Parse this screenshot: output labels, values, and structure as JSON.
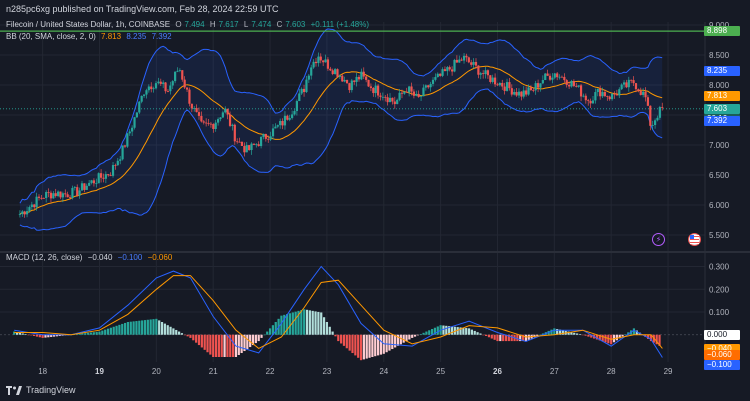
{
  "header": {
    "published": "n285pc6xg published on TradingView.com, Feb 28, 2024 22:59 UTC"
  },
  "symbol_legend": {
    "name": "Filecoin / United States Dollar, 1h, COINBASE",
    "o_label": "O",
    "o_value": "7.494",
    "h_label": "H",
    "h_value": "7.617",
    "l_label": "L",
    "l_value": "7.474",
    "c_label": "C",
    "c_value": "7.603",
    "change": "+0.111 (+1.48%)"
  },
  "bb_legend": {
    "label": "BB (20, SMA, close, 2, 0)",
    "basis": "7.813",
    "upper": "8.235",
    "lower": "7.392"
  },
  "macd_legend": {
    "label": "MACD (12, 26, close)",
    "hist": "−0.040",
    "macd": "−0.100",
    "signal": "−0.060"
  },
  "price_axis": {
    "ticks": [
      "9.000",
      "8.500",
      "8.000",
      "7.500",
      "7.000",
      "6.500",
      "6.000",
      "5.500"
    ],
    "tags": [
      {
        "label": "8.898",
        "color": "#4caf50"
      },
      {
        "label": "8.235",
        "color": "#2962ff"
      },
      {
        "label": "7.813",
        "color": "#ff9800"
      },
      {
        "label": "7.603",
        "color": "#26a69a"
      },
      {
        "label": "00:16",
        "color": "#26a69a"
      },
      {
        "label": "7.392",
        "color": "#2962ff"
      }
    ]
  },
  "macd_axis": {
    "ticks": [
      "0.300",
      "0.200",
      "0.100",
      "0.000"
    ],
    "tags": [
      {
        "label": "0.000",
        "color": "#ffffff"
      },
      {
        "label": "−0.040",
        "color": "#ff9800"
      },
      {
        "label": "−0.060",
        "color": "#ff6d00"
      },
      {
        "label": "−0.100",
        "color": "#2962ff"
      }
    ]
  },
  "time_axis": {
    "labels": [
      "18",
      "19",
      "20",
      "21",
      "22",
      "23",
      "24",
      "25",
      "26",
      "27",
      "28",
      "29"
    ],
    "bold": [
      "19",
      "26"
    ]
  },
  "footer": {
    "brand": "TradingView"
  },
  "colors": {
    "bg": "#161a25",
    "up": "#26a69a",
    "down": "#ef5350",
    "basis": "#ff9800",
    "band": "#2962ff",
    "resistance": "#4caf50",
    "macd": "#2962ff",
    "signal": "#ff9800"
  },
  "chart_data": {
    "type": "candlestick",
    "xlabel": "",
    "ylabel": "",
    "ylim": [
      5.3,
      9.05
    ],
    "x_range": [
      "Feb 17",
      "Feb 29"
    ],
    "resistance_level": 8.898,
    "close_path": [
      [
        17.6,
        5.85
      ],
      [
        17.8,
        6.0
      ],
      [
        18.0,
        6.15
      ],
      [
        18.2,
        6.2
      ],
      [
        18.4,
        6.18
      ],
      [
        18.6,
        6.22
      ],
      [
        18.8,
        6.35
      ],
      [
        19.0,
        6.45
      ],
      [
        19.2,
        6.55
      ],
      [
        19.4,
        6.9
      ],
      [
        19.6,
        7.4
      ],
      [
        19.8,
        7.95
      ],
      [
        20.0,
        8.05
      ],
      [
        20.2,
        7.9
      ],
      [
        20.4,
        8.3
      ],
      [
        20.6,
        7.7
      ],
      [
        20.8,
        7.3
      ],
      [
        21.0,
        7.35
      ],
      [
        21.2,
        7.6
      ],
      [
        21.4,
        7.1
      ],
      [
        21.6,
        6.9
      ],
      [
        21.8,
        7.05
      ],
      [
        22.0,
        7.2
      ],
      [
        22.2,
        7.35
      ],
      [
        22.4,
        7.6
      ],
      [
        22.6,
        7.95
      ],
      [
        22.7,
        8.3
      ],
      [
        22.85,
        8.5
      ],
      [
        23.0,
        8.35
      ],
      [
        23.2,
        8.2
      ],
      [
        23.4,
        8.0
      ],
      [
        23.6,
        8.15
      ],
      [
        23.8,
        7.95
      ],
      [
        24.0,
        7.85
      ],
      [
        24.2,
        7.7
      ],
      [
        24.4,
        7.95
      ],
      [
        24.6,
        7.75
      ],
      [
        24.8,
        8.0
      ],
      [
        25.0,
        8.15
      ],
      [
        25.2,
        8.3
      ],
      [
        25.4,
        8.45
      ],
      [
        25.6,
        8.3
      ],
      [
        25.8,
        8.15
      ],
      [
        26.0,
        8.05
      ],
      [
        26.2,
        7.95
      ],
      [
        26.4,
        7.85
      ],
      [
        26.6,
        7.9
      ],
      [
        26.8,
        8.1
      ],
      [
        27.0,
        8.2
      ],
      [
        27.2,
        8.1
      ],
      [
        27.4,
        7.95
      ],
      [
        27.6,
        7.75
      ],
      [
        27.8,
        7.9
      ],
      [
        28.0,
        7.8
      ],
      [
        28.2,
        7.95
      ],
      [
        28.4,
        8.05
      ],
      [
        28.6,
        7.8
      ],
      [
        28.7,
        7.3
      ],
      [
        28.8,
        7.5
      ],
      [
        28.9,
        7.603
      ]
    ],
    "macd": {
      "ylim": [
        -0.12,
        0.32
      ],
      "macd_path": [
        [
          17.5,
          0.02
        ],
        [
          18.0,
          0.0
        ],
        [
          18.5,
          0.0
        ],
        [
          19.0,
          0.03
        ],
        [
          19.5,
          0.13
        ],
        [
          20.0,
          0.25
        ],
        [
          20.3,
          0.28
        ],
        [
          20.6,
          0.25
        ],
        [
          21.0,
          0.08
        ],
        [
          21.4,
          -0.05
        ],
        [
          21.8,
          -0.08
        ],
        [
          22.2,
          0.05
        ],
        [
          22.6,
          0.2
        ],
        [
          22.9,
          0.3
        ],
        [
          23.2,
          0.22
        ],
        [
          23.6,
          0.05
        ],
        [
          24.0,
          -0.04
        ],
        [
          24.5,
          -0.05
        ],
        [
          25.0,
          0.02
        ],
        [
          25.5,
          0.06
        ],
        [
          26.0,
          0.01
        ],
        [
          26.5,
          -0.03
        ],
        [
          27.0,
          0.02
        ],
        [
          27.5,
          0.02
        ],
        [
          28.0,
          -0.05
        ],
        [
          28.4,
          0.02
        ],
        [
          28.7,
          -0.02
        ],
        [
          28.9,
          -0.1
        ]
      ],
      "signal_path": [
        [
          17.5,
          0.01
        ],
        [
          18.0,
          0.01
        ],
        [
          18.5,
          0.0
        ],
        [
          19.0,
          0.02
        ],
        [
          19.5,
          0.09
        ],
        [
          20.0,
          0.2
        ],
        [
          20.3,
          0.26
        ],
        [
          20.6,
          0.26
        ],
        [
          21.0,
          0.15
        ],
        [
          21.4,
          0.02
        ],
        [
          21.8,
          -0.06
        ],
        [
          22.2,
          -0.01
        ],
        [
          22.6,
          0.12
        ],
        [
          22.9,
          0.23
        ],
        [
          23.2,
          0.24
        ],
        [
          23.6,
          0.13
        ],
        [
          24.0,
          0.02
        ],
        [
          24.5,
          -0.04
        ],
        [
          25.0,
          -0.01
        ],
        [
          25.5,
          0.04
        ],
        [
          26.0,
          0.03
        ],
        [
          26.5,
          -0.01
        ],
        [
          27.0,
          0.0
        ],
        [
          27.5,
          0.02
        ],
        [
          28.0,
          -0.02
        ],
        [
          28.4,
          0.0
        ],
        [
          28.7,
          0.0
        ],
        [
          28.9,
          -0.06
        ]
      ]
    }
  }
}
